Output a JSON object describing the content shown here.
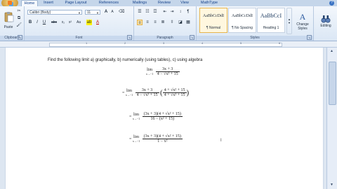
{
  "tabs": [
    "Home",
    "Insert",
    "Page Layout",
    "References",
    "Mailings",
    "Review",
    "View",
    "MathType"
  ],
  "active_tab": "Home",
  "clipboard": {
    "paste_label": "Paste",
    "group_label": "Clipboard"
  },
  "font": {
    "name": "Calibri (Body)",
    "size": "11",
    "group_label": "Font",
    "bold": "B",
    "italic": "I",
    "underline": "U",
    "strike": "abc",
    "subscript": "x₂",
    "superscript": "x²",
    "case": "Aa",
    "grow": "A",
    "shrink": "A"
  },
  "paragraph": {
    "group_label": "Paragraph"
  },
  "styles": {
    "group_label": "Styles",
    "items": [
      {
        "sample": "AaBbCcDdI",
        "name": "¶ Normal"
      },
      {
        "sample": "AaBbCcDdI",
        "name": "¶ No Spacing"
      },
      {
        "sample": "AaBbCcI",
        "name": "Heading 1"
      }
    ],
    "change_styles": "Change Styles",
    "editing": "Editing"
  },
  "document": {
    "instruction": "Find the following limit a) graphically, b) numerically (using tables), c) using algebra",
    "expr1": {
      "lim": "lim",
      "sub": "x→−1",
      "num": "3x + 3",
      "den": "4 − √x² + 15"
    },
    "expr2": {
      "eq": "=",
      "lim": "lim",
      "sub": "x→−1",
      "num": "3x + 3",
      "den": "4 − √x² + 15",
      "rnum": "4 + √x² + 15",
      "rden": "4 + √x² + 15"
    },
    "expr3": {
      "eq": "=",
      "lim": "lim",
      "sub": "x→−1",
      "num": "(3x + 3)(4 + √x² + 15)",
      "den": "16 − (x² + 15)"
    },
    "expr4": {
      "eq": "=",
      "lim": "lim",
      "sub": "x→−1",
      "num": "(3x + 3)(4 + √x² + 15)",
      "den": "1 − x²"
    }
  },
  "ruler_numbers": [
    "1",
    "2",
    "3",
    "4",
    "5",
    "6"
  ],
  "colors": {
    "ribbon": "#dbe7f5",
    "accent": "#15428b"
  }
}
